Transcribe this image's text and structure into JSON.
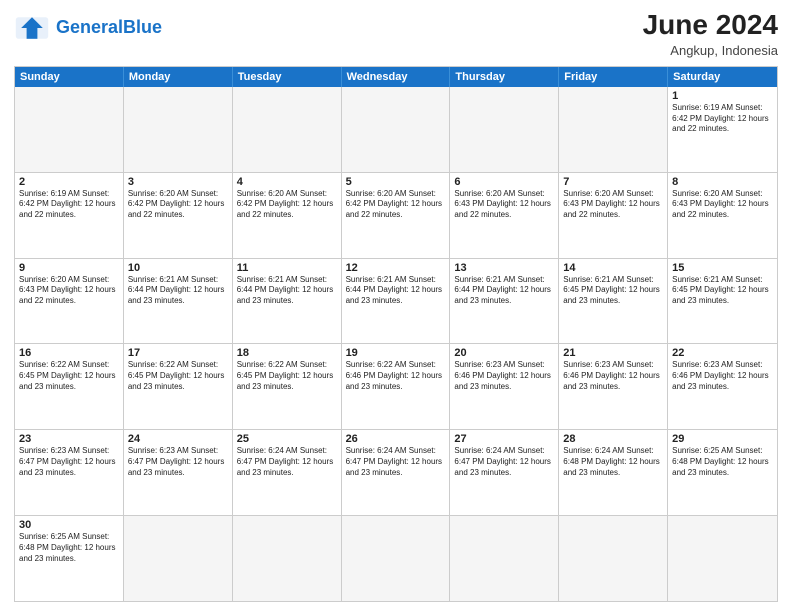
{
  "header": {
    "logo_general": "General",
    "logo_blue": "Blue",
    "month_year": "June 2024",
    "location": "Angkup, Indonesia"
  },
  "day_headers": [
    "Sunday",
    "Monday",
    "Tuesday",
    "Wednesday",
    "Thursday",
    "Friday",
    "Saturday"
  ],
  "weeks": [
    [
      {
        "date": "",
        "info": "",
        "empty": true
      },
      {
        "date": "",
        "info": "",
        "empty": true
      },
      {
        "date": "",
        "info": "",
        "empty": true
      },
      {
        "date": "",
        "info": "",
        "empty": true
      },
      {
        "date": "",
        "info": "",
        "empty": true
      },
      {
        "date": "",
        "info": "",
        "empty": true
      },
      {
        "date": "1",
        "info": "Sunrise: 6:19 AM\nSunset: 6:42 PM\nDaylight: 12 hours and 22 minutes."
      }
    ],
    [
      {
        "date": "2",
        "info": "Sunrise: 6:19 AM\nSunset: 6:42 PM\nDaylight: 12 hours and 22 minutes."
      },
      {
        "date": "3",
        "info": "Sunrise: 6:20 AM\nSunset: 6:42 PM\nDaylight: 12 hours and 22 minutes."
      },
      {
        "date": "4",
        "info": "Sunrise: 6:20 AM\nSunset: 6:42 PM\nDaylight: 12 hours and 22 minutes."
      },
      {
        "date": "5",
        "info": "Sunrise: 6:20 AM\nSunset: 6:42 PM\nDaylight: 12 hours and 22 minutes."
      },
      {
        "date": "6",
        "info": "Sunrise: 6:20 AM\nSunset: 6:43 PM\nDaylight: 12 hours and 22 minutes."
      },
      {
        "date": "7",
        "info": "Sunrise: 6:20 AM\nSunset: 6:43 PM\nDaylight: 12 hours and 22 minutes."
      },
      {
        "date": "8",
        "info": "Sunrise: 6:20 AM\nSunset: 6:43 PM\nDaylight: 12 hours and 22 minutes."
      }
    ],
    [
      {
        "date": "9",
        "info": "Sunrise: 6:20 AM\nSunset: 6:43 PM\nDaylight: 12 hours and 22 minutes."
      },
      {
        "date": "10",
        "info": "Sunrise: 6:21 AM\nSunset: 6:44 PM\nDaylight: 12 hours and 23 minutes."
      },
      {
        "date": "11",
        "info": "Sunrise: 6:21 AM\nSunset: 6:44 PM\nDaylight: 12 hours and 23 minutes."
      },
      {
        "date": "12",
        "info": "Sunrise: 6:21 AM\nSunset: 6:44 PM\nDaylight: 12 hours and 23 minutes."
      },
      {
        "date": "13",
        "info": "Sunrise: 6:21 AM\nSunset: 6:44 PM\nDaylight: 12 hours and 23 minutes."
      },
      {
        "date": "14",
        "info": "Sunrise: 6:21 AM\nSunset: 6:45 PM\nDaylight: 12 hours and 23 minutes."
      },
      {
        "date": "15",
        "info": "Sunrise: 6:21 AM\nSunset: 6:45 PM\nDaylight: 12 hours and 23 minutes."
      }
    ],
    [
      {
        "date": "16",
        "info": "Sunrise: 6:22 AM\nSunset: 6:45 PM\nDaylight: 12 hours and 23 minutes."
      },
      {
        "date": "17",
        "info": "Sunrise: 6:22 AM\nSunset: 6:45 PM\nDaylight: 12 hours and 23 minutes."
      },
      {
        "date": "18",
        "info": "Sunrise: 6:22 AM\nSunset: 6:45 PM\nDaylight: 12 hours and 23 minutes."
      },
      {
        "date": "19",
        "info": "Sunrise: 6:22 AM\nSunset: 6:46 PM\nDaylight: 12 hours and 23 minutes."
      },
      {
        "date": "20",
        "info": "Sunrise: 6:23 AM\nSunset: 6:46 PM\nDaylight: 12 hours and 23 minutes."
      },
      {
        "date": "21",
        "info": "Sunrise: 6:23 AM\nSunset: 6:46 PM\nDaylight: 12 hours and 23 minutes."
      },
      {
        "date": "22",
        "info": "Sunrise: 6:23 AM\nSunset: 6:46 PM\nDaylight: 12 hours and 23 minutes."
      }
    ],
    [
      {
        "date": "23",
        "info": "Sunrise: 6:23 AM\nSunset: 6:47 PM\nDaylight: 12 hours and 23 minutes."
      },
      {
        "date": "24",
        "info": "Sunrise: 6:23 AM\nSunset: 6:47 PM\nDaylight: 12 hours and 23 minutes."
      },
      {
        "date": "25",
        "info": "Sunrise: 6:24 AM\nSunset: 6:47 PM\nDaylight: 12 hours and 23 minutes."
      },
      {
        "date": "26",
        "info": "Sunrise: 6:24 AM\nSunset: 6:47 PM\nDaylight: 12 hours and 23 minutes."
      },
      {
        "date": "27",
        "info": "Sunrise: 6:24 AM\nSunset: 6:47 PM\nDaylight: 12 hours and 23 minutes."
      },
      {
        "date": "28",
        "info": "Sunrise: 6:24 AM\nSunset: 6:48 PM\nDaylight: 12 hours and 23 minutes."
      },
      {
        "date": "29",
        "info": "Sunrise: 6:25 AM\nSunset: 6:48 PM\nDaylight: 12 hours and 23 minutes."
      }
    ],
    [
      {
        "date": "30",
        "info": "Sunrise: 6:25 AM\nSunset: 6:48 PM\nDaylight: 12 hours and 23 minutes."
      },
      {
        "date": "",
        "info": "",
        "empty": true
      },
      {
        "date": "",
        "info": "",
        "empty": true
      },
      {
        "date": "",
        "info": "",
        "empty": true
      },
      {
        "date": "",
        "info": "",
        "empty": true
      },
      {
        "date": "",
        "info": "",
        "empty": true
      },
      {
        "date": "",
        "info": "",
        "empty": true
      }
    ]
  ]
}
